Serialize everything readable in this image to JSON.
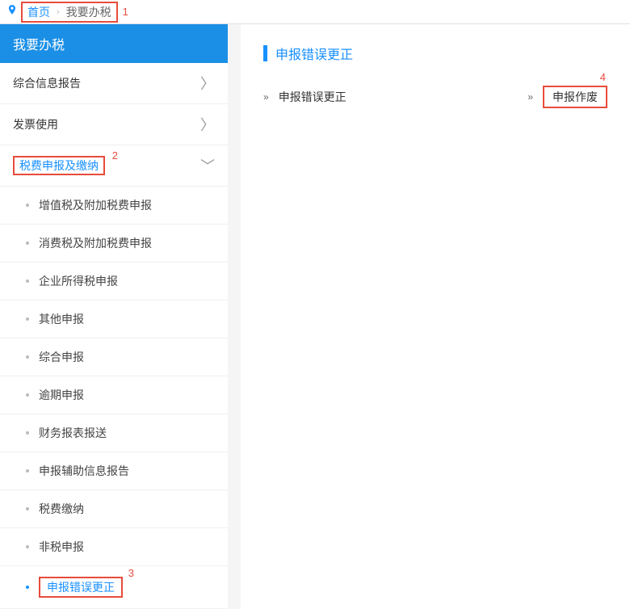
{
  "breadcrumb": {
    "home": "首页",
    "current": "我要办税"
  },
  "annotations": {
    "a1": "1",
    "a2": "2",
    "a3": "3",
    "a4": "4"
  },
  "sidebar": {
    "title": "我要办税",
    "categories": [
      {
        "label": "综合信息报告",
        "arrow": "〉"
      },
      {
        "label": "发票使用",
        "arrow": "〉"
      },
      {
        "label": "税费申报及缴纳",
        "arrow": "﹀"
      }
    ],
    "subitems": [
      "增值税及附加税费申报",
      "消费税及附加税费申报",
      "企业所得税申报",
      "其他申报",
      "综合申报",
      "逾期申报",
      "财务报表报送",
      "申报辅助信息报告",
      "税费缴纳",
      "非税申报",
      "申报错误更正"
    ]
  },
  "content": {
    "title": "申报错误更正",
    "items": [
      "申报错误更正",
      "申报作废"
    ]
  },
  "icons": {
    "item_arrow": "»"
  }
}
